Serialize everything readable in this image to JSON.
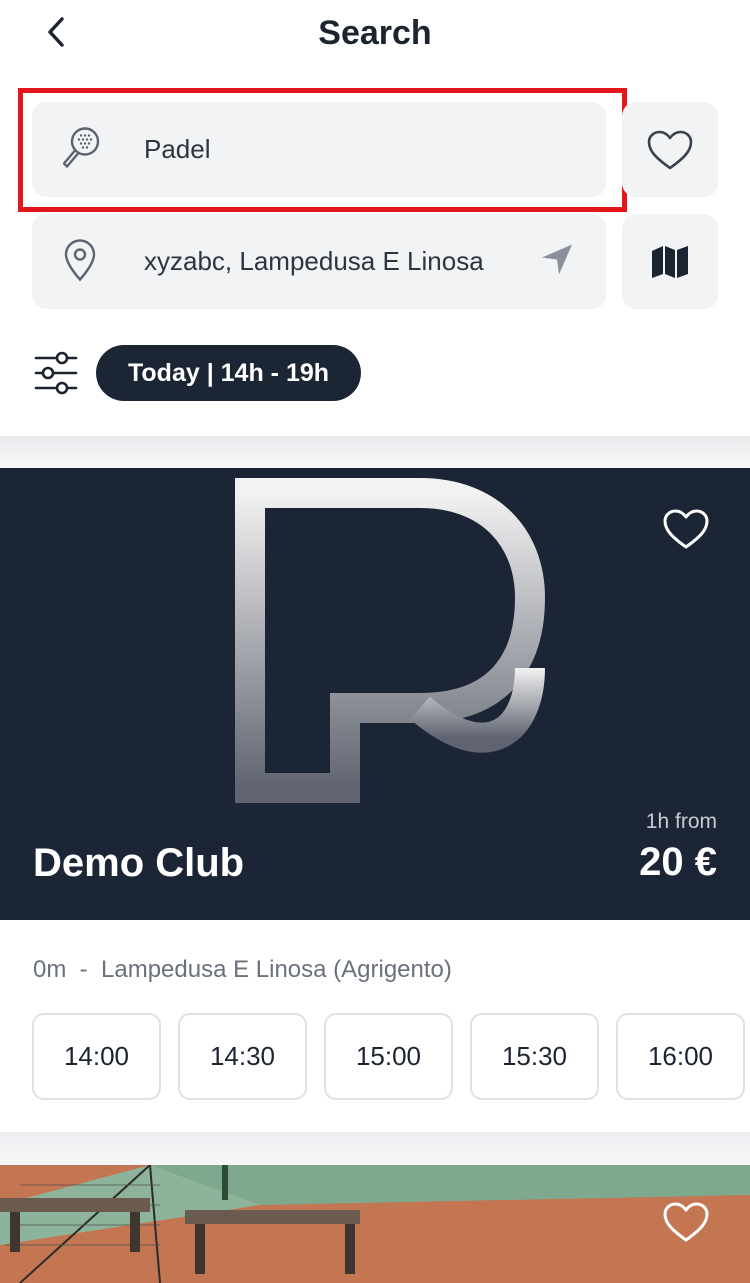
{
  "header": {
    "title": "Search"
  },
  "search": {
    "sport_value": "Padel",
    "location_value": "xyzabc, Lampedusa E Linosa"
  },
  "filters": {
    "time_chip": "Today | 14h - 19h"
  },
  "clubs": [
    {
      "name": "Demo Club",
      "price_from_label": "1h from",
      "price": "20 €",
      "distance_line": "0m  -  Lampedusa E Linosa (Agrigento)",
      "slots": [
        "14:00",
        "14:30",
        "15:00",
        "15:30",
        "16:00"
      ]
    }
  ],
  "colors": {
    "accent_dark": "#1c2533",
    "field_bg": "#f2f3f5",
    "highlight": "#e3161e"
  }
}
